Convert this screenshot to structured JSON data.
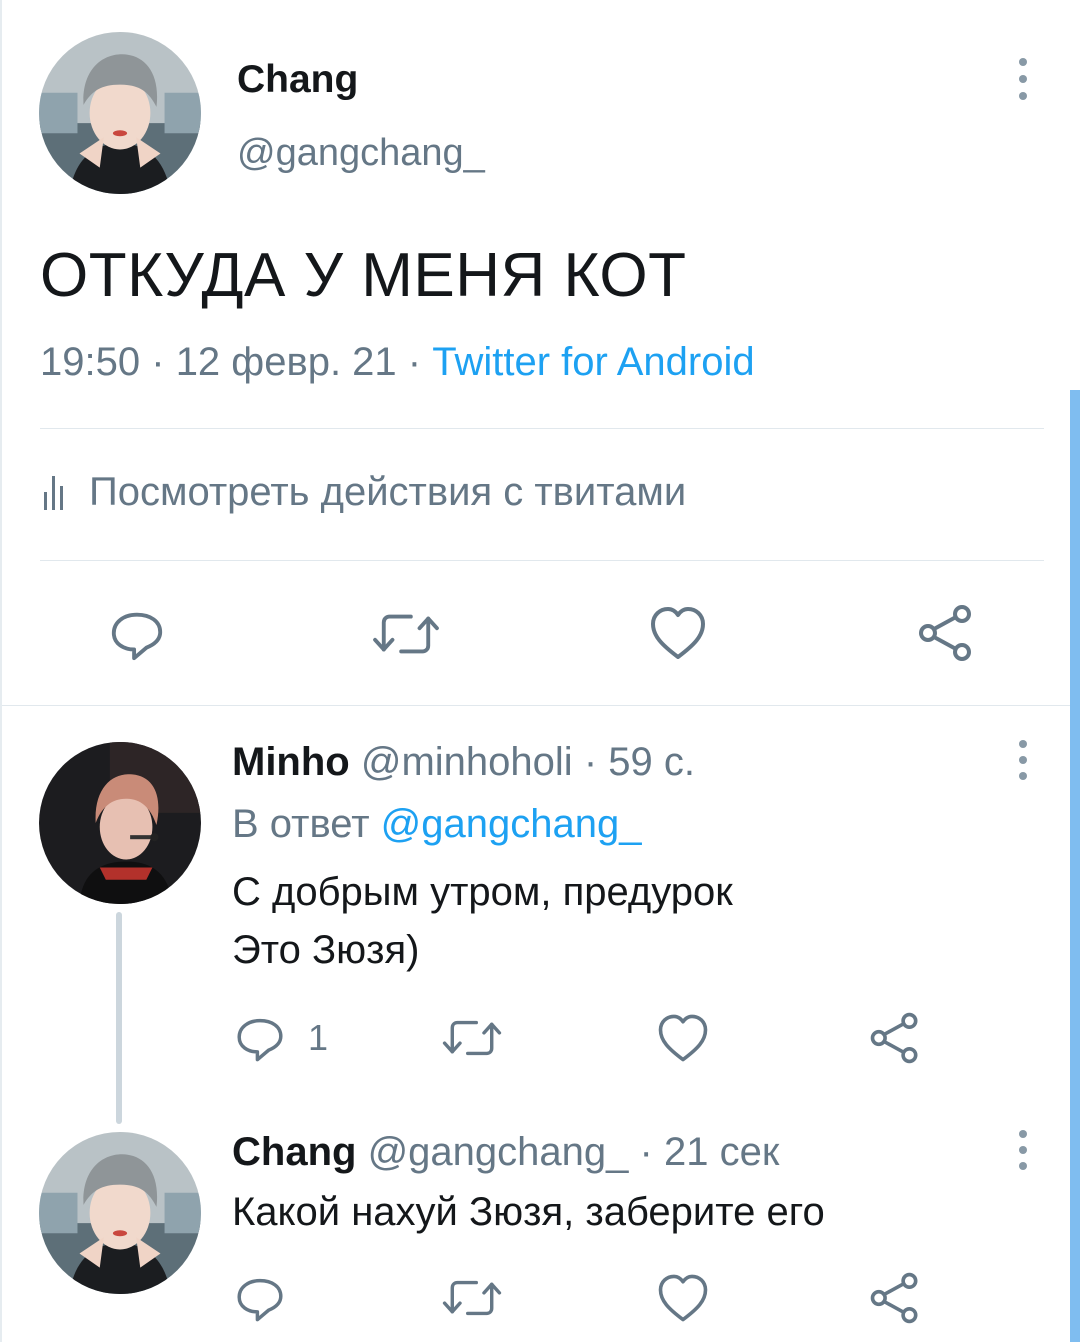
{
  "main_tweet": {
    "author_name": "Chang",
    "author_handle": "@gangchang_",
    "text": "ОТКУДА У МЕНЯ КОТ",
    "time": "19:50",
    "date": "12 февр. 21",
    "separator": "·",
    "source": "Twitter for Android",
    "analytics_label": "Посмотреть действия с твитами"
  },
  "replies": [
    {
      "author_name": "Minho",
      "author_handle": "@minhoholi",
      "time": "59 с.",
      "reply_prefix": "В ответ",
      "reply_to": "@gangchang_",
      "text_lines": [
        "С добрым утром, предурок",
        "Это Зюзя)"
      ],
      "reply_count": "1"
    },
    {
      "author_name": "Chang",
      "author_handle": "@gangchang_",
      "time": "21 сек",
      "text_lines": [
        "Какой нахуй Зюзя, заберите его"
      ]
    }
  ],
  "icons": [
    "reply-icon",
    "retweet-icon",
    "like-icon",
    "share-icon",
    "more-icon",
    "analytics-icon"
  ],
  "colors": {
    "accent": "#1da1f2",
    "muted": "#657786",
    "icon": "#657786",
    "divider": "#e1e8ed"
  }
}
